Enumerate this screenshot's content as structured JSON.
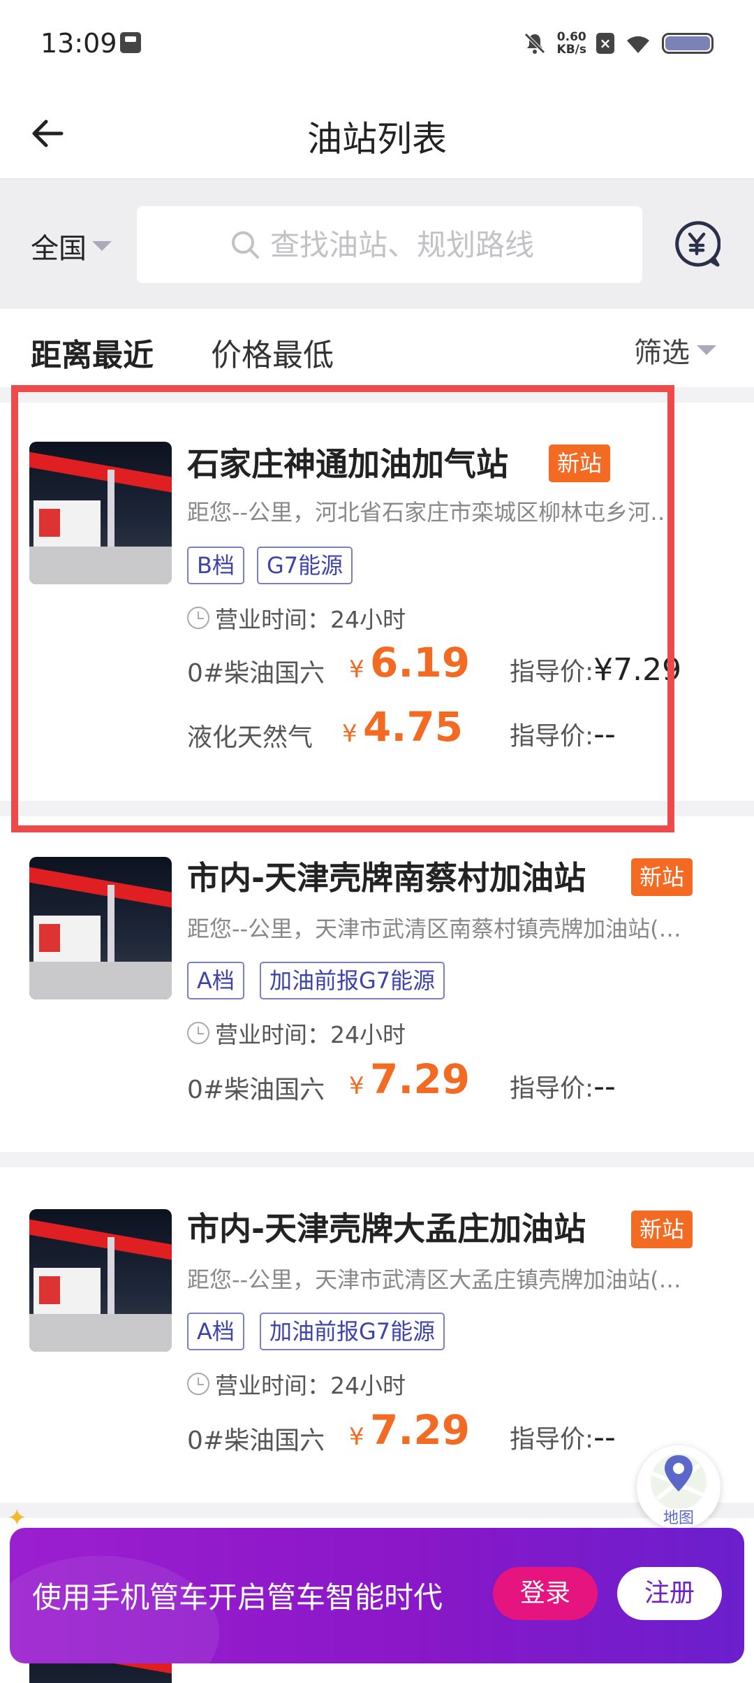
{
  "status_bar": {
    "time": "13:09",
    "net_speed_value": "0.60",
    "net_speed_unit": "KB/s"
  },
  "header": {
    "title": "油站列表"
  },
  "search": {
    "region": "全国",
    "placeholder": "查找油站、规划路线"
  },
  "sort": {
    "tabs": [
      "距离最近",
      "价格最低"
    ],
    "active_tab": "距离最近",
    "filter_label": "筛选"
  },
  "stations": [
    {
      "name": "石家庄神通加油加气站",
      "badge": "新站",
      "distance": "距您--公里，河北省石家庄市栾城区柳林屯乡河…",
      "tags": [
        "B档",
        "G7能源"
      ],
      "hours": "营业时间：24小时",
      "fuels": [
        {
          "name": "0#柴油国六",
          "currency": "¥",
          "price": "6.19",
          "guide_label": "指导价:",
          "guide_value": "¥7.29"
        },
        {
          "name": "液化天然气",
          "currency": "¥",
          "price": "4.75",
          "guide_label": "指导价:",
          "guide_value": "--"
        }
      ]
    },
    {
      "name": "市内-天津壳牌南蔡村加油站",
      "badge": "新站",
      "distance": "距您--公里，天津市武清区南蔡村镇壳牌加油站(…",
      "tags": [
        "A档",
        "加油前报G7能源"
      ],
      "hours": "营业时间：24小时",
      "fuels": [
        {
          "name": "0#柴油国六",
          "currency": "¥",
          "price": "7.29",
          "guide_label": "指导价:",
          "guide_value": "--"
        }
      ]
    },
    {
      "name": "市内-天津壳牌大孟庄加油站",
      "badge": "新站",
      "distance": "距您--公里，天津市武清区大孟庄镇壳牌加油站(…",
      "tags": [
        "A档",
        "加油前报G7能源"
      ],
      "hours": "营业时间：24小时",
      "fuels": [
        {
          "name": "0#柴油国六",
          "currency": "¥",
          "price": "7.29",
          "guide_label": "指导价:",
          "guide_value": "--"
        }
      ]
    }
  ],
  "map_button": {
    "label": "地图"
  },
  "banner": {
    "text": "使用手机管车开启管车智能时代",
    "login": "登录",
    "register": "注册"
  },
  "colors": {
    "accent_orange": "#f36a23",
    "tag_purple": "#3d43a8",
    "banner_purple": "#8a17c8",
    "highlight_red": "#ee4a4a"
  }
}
